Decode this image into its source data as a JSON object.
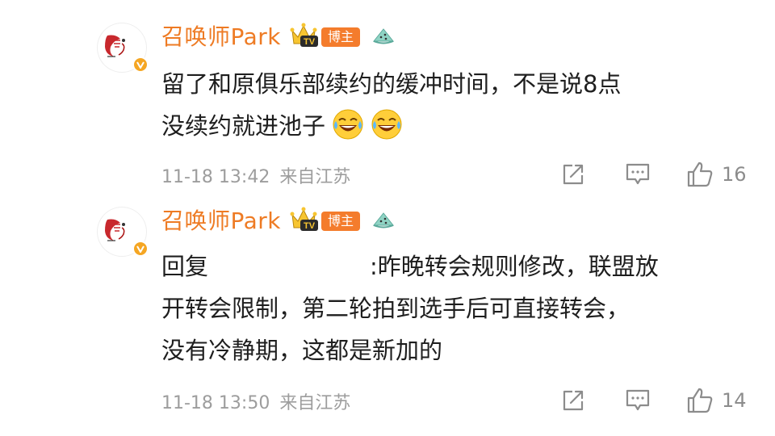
{
  "comments": [
    {
      "username": "召唤师Park",
      "badge_label": "博主",
      "text_line1": "留了和原俱乐部续约的缓冲时间，不是说8点",
      "text_line2": "没续约就进池子",
      "emoji_icons": [
        "laugh-cry-emoji-icon",
        "laugh-cry-emoji-icon"
      ],
      "time": "11-18 13:42",
      "location": "来自江苏",
      "like_count": "16"
    },
    {
      "username": "召唤师Park",
      "badge_label": "博主",
      "reply_prefix": "回复",
      "reply_rest": ":昨晚转会规则修改，联盟放",
      "text_line2": "开转会限制，第二轮拍到选手后可直接转会，",
      "text_line3": "没有冷静期，这都是新加的",
      "time": "11-18 13:50",
      "location": "来自江苏",
      "like_count": "14"
    }
  ],
  "colors": {
    "username": "#ee7b24",
    "badge_bg": "#f47c2c",
    "meta_text": "#9d9d9d",
    "body_text": "#1e1e1e",
    "icon_gray": "#8c8c8c"
  }
}
